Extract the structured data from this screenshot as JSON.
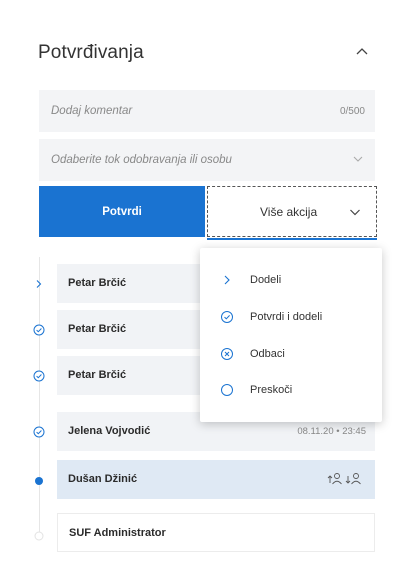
{
  "panel": {
    "title": "Potvrđivanja"
  },
  "comment": {
    "placeholder": "Dodaj komentar",
    "counter": "0/500"
  },
  "flow_select": {
    "placeholder": "Odaberite tok odobravanja ili osobu"
  },
  "actions": {
    "confirm_label": "Potvrdi",
    "more_label": "Više akcija"
  },
  "menu": {
    "items": [
      {
        "label": "Dodeli",
        "icon": "chevron-right-icon"
      },
      {
        "label": "Potvrdi i dodeli",
        "icon": "check-circle-icon"
      },
      {
        "label": "Odbaci",
        "icon": "x-circle-icon"
      },
      {
        "label": "Preskoči",
        "icon": "circle-icon"
      }
    ]
  },
  "steps": [
    {
      "name": "Petar Brčić",
      "status": "current-arrow"
    },
    {
      "name": "Petar Brčić",
      "status": "approved"
    },
    {
      "name": "Petar Brčić",
      "status": "approved"
    },
    {
      "name": "Jelena Vojvodić",
      "status": "approved",
      "time": "08.11.20 • 23:45"
    },
    {
      "name": "Dušan Džinić",
      "status": "active"
    },
    {
      "name": "SUF Administrator",
      "status": "pending"
    }
  ],
  "colors": {
    "accent": "#1a73d1",
    "active_step": "#dfe9f4",
    "step_bg": "#f1f3f6"
  }
}
